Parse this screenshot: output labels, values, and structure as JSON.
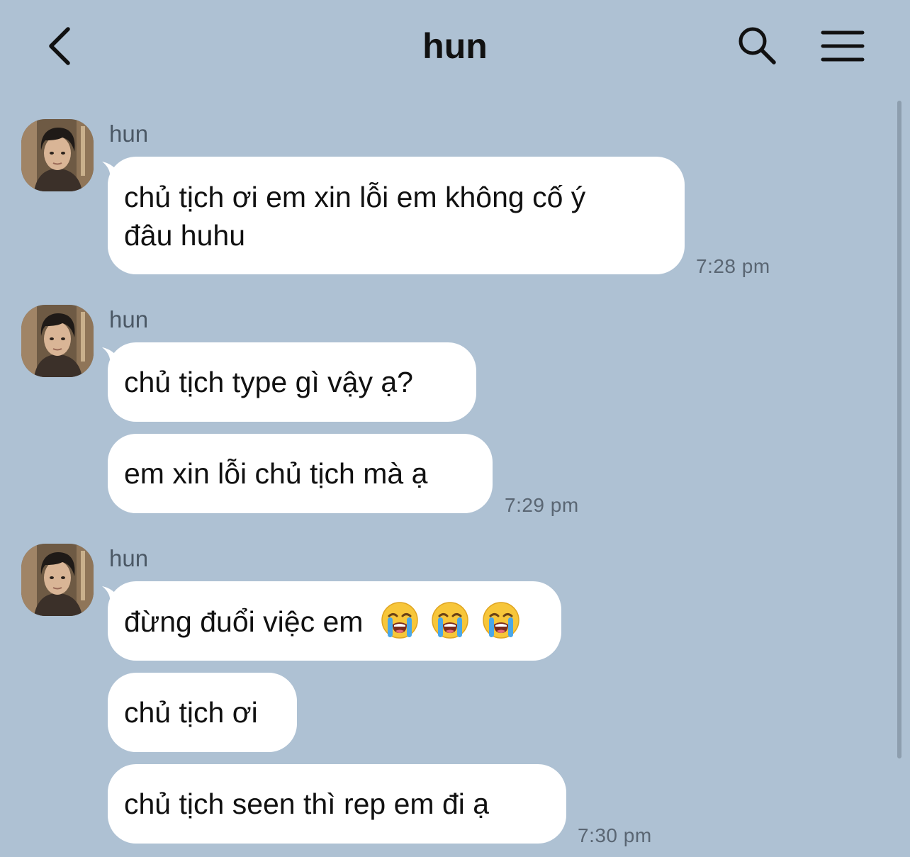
{
  "header": {
    "title": "hun",
    "back_icon": "chevron-left-icon",
    "search_icon": "search-icon",
    "menu_icon": "hamburger-menu-icon"
  },
  "colors": {
    "background": "#aec1d3",
    "bubble": "#ffffff",
    "text": "#111111",
    "timestamp": "#5a6673"
  },
  "groups": [
    {
      "sender": "hun",
      "messages": [
        {
          "line1": "chủ tịch ơi em xin lỗi em không cố ý",
          "line2": "đâu huhu"
        }
      ],
      "time": "7:28 pm"
    },
    {
      "sender": "hun",
      "messages": [
        {
          "text": "chủ tịch type gì vậy ạ?"
        },
        {
          "text": "em xin lỗi chủ tịch mà ạ"
        }
      ],
      "time": "7:29 pm"
    },
    {
      "sender": "hun",
      "messages": [
        {
          "text": "đừng đuổi việc em",
          "emoji": "loudly-crying-face-icon",
          "emoji_count": 3
        },
        {
          "text": "chủ tịch ơi"
        },
        {
          "text": "chủ tịch seen thì rep em đi ạ"
        }
      ],
      "time": "7:30 pm"
    }
  ]
}
